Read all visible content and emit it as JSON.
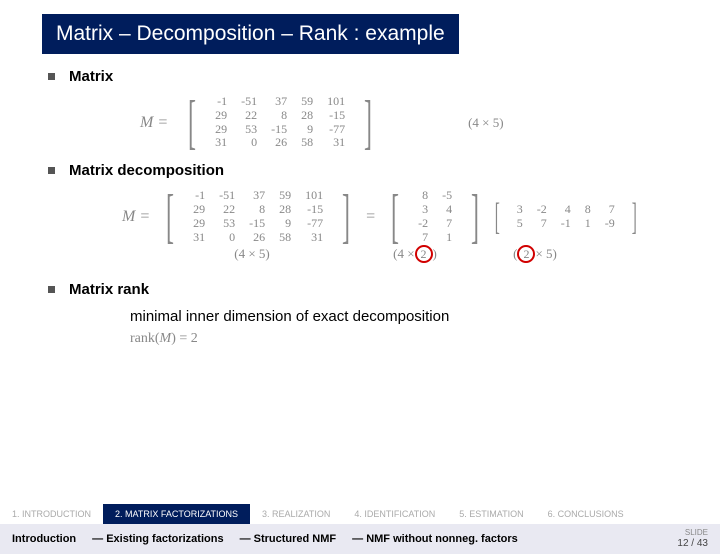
{
  "title": "Matrix – Decomposition – Rank : example",
  "sections": {
    "s1_label": "Matrix",
    "s2_label": "Matrix decomposition",
    "s3_label": "Matrix rank",
    "s3_sub": "minimal inner dimension of exact decomposition"
  },
  "chart_data": {
    "type": "table",
    "M_symbol": "M =",
    "M": [
      [
        -1,
        -51,
        37,
        59,
        101
      ],
      [
        29,
        22,
        8,
        28,
        -15
      ],
      [
        29,
        53,
        -15,
        9,
        -77
      ],
      [
        31,
        0,
        26,
        58,
        31
      ]
    ],
    "M_dim": "(4 × 5)",
    "A": [
      [
        8,
        -5
      ],
      [
        3,
        4
      ],
      [
        -2,
        7
      ],
      [
        7,
        1
      ]
    ],
    "A_dim_pre": "(4 ×",
    "A_dim_circ": "2",
    "A_dim_post": ")",
    "B": [
      [
        3,
        -2,
        4,
        8,
        7
      ],
      [
        5,
        7,
        -1,
        1,
        -9
      ]
    ],
    "B_dim_pre": "(",
    "B_dim_circ": "2",
    "B_dim_post": "× 5)",
    "eq": "=",
    "rank_expr": "rank(M) = 2"
  },
  "tabs": {
    "t1": "1. INTRODUCTION",
    "t2": "2. MATRIX FACTORIZATIONS",
    "t3": "3. REALIZATION",
    "t4": "4. IDENTIFICATION",
    "t5": "5. ESTIMATION",
    "t6": "6. CONCLUSIONS"
  },
  "footer": {
    "lead": "Introduction",
    "i1": "— Existing factorizations",
    "i2": "— Structured NMF",
    "i3": "— NMF without nonneg. factors",
    "slide_label": "SLIDE",
    "page": "12 / 43"
  }
}
